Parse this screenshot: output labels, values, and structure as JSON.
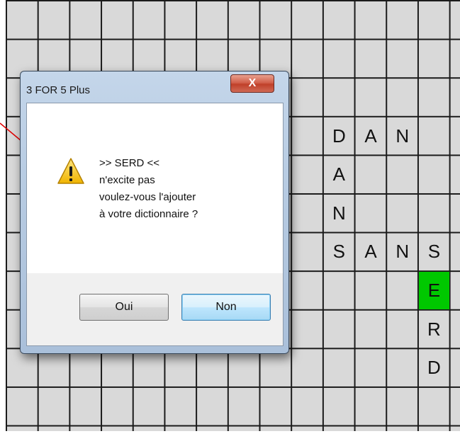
{
  "board": {
    "letters": [
      {
        "text": "D",
        "col": 10,
        "row": 3,
        "highlight": false
      },
      {
        "text": "A",
        "col": 11,
        "row": 3,
        "highlight": false
      },
      {
        "text": "N",
        "col": 12,
        "row": 3,
        "highlight": false
      },
      {
        "text": "A",
        "col": 10,
        "row": 4,
        "highlight": false
      },
      {
        "text": "N",
        "col": 10,
        "row": 5,
        "highlight": false
      },
      {
        "text": "S",
        "col": 10,
        "row": 6,
        "highlight": false
      },
      {
        "text": "A",
        "col": 11,
        "row": 6,
        "highlight": false
      },
      {
        "text": "N",
        "col": 12,
        "row": 6,
        "highlight": false
      },
      {
        "text": "S",
        "col": 13,
        "row": 6,
        "highlight": false
      },
      {
        "text": "E",
        "col": 13,
        "row": 7,
        "highlight": true
      },
      {
        "text": "R",
        "col": 13,
        "row": 8,
        "highlight": false
      },
      {
        "text": "D",
        "col": 13,
        "row": 9,
        "highlight": false
      }
    ],
    "highlight_color": "#00c800"
  },
  "dialog": {
    "title": "3 FOR 5 Plus",
    "close_label": "X",
    "icon": "warning-icon",
    "message_lines": [
      ">> SERD <<",
      "n'excite pas",
      "voulez-vous l'ajouter",
      "à votre dictionnaire ?"
    ],
    "buttons": {
      "yes": "Oui",
      "no": "Non"
    }
  },
  "annotation": {
    "arrow_color": "#e00000"
  }
}
